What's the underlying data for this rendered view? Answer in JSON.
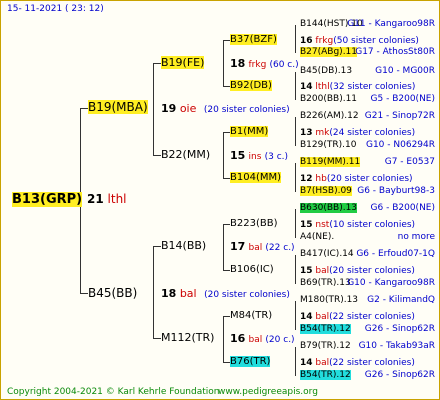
{
  "header": {
    "date": "15- 11-2021 ( 23: 12)"
  },
  "footer": {
    "copyright": "Copyright 2004-2021 © Karl Kehrle Foundation",
    "site": "www.pedigreeapis.org"
  },
  "root": {
    "name": "B13(GRP)",
    "num": "21",
    "place": "lthl"
  },
  "p": {
    "name": "B19(MBA)",
    "num": "19",
    "place": "oie",
    "note": "(20 sister colonies)",
    "p": {
      "name": "B19(FE)",
      "num": "18",
      "place": "frkg",
      "note": "(60 c.)",
      "p": {
        "name": "B37(BZF)",
        "num": "16",
        "place": "frkg",
        "note": "(50 sister colonies)",
        "p": {
          "name": "B144(HST).10",
          "ref": "G11 - Kangaroo98R"
        },
        "m": {
          "name": "B27(ABg).11",
          "ref": "G17 - AthosSt80R"
        }
      },
      "m": {
        "name": "B92(DB)",
        "num": "14",
        "place": "lthl",
        "note": "(32 sister colonies)",
        "p": {
          "name": "B45(DB).13",
          "ref": "G10 - MG00R"
        },
        "m": {
          "name": "B200(BB).11",
          "ref": "G5 - B200(NE)"
        }
      }
    },
    "m": {
      "name": "B22(MM)",
      "num": "15",
      "place": "ins",
      "note": "(3 c.)",
      "p": {
        "name": "B1(MM)",
        "num": "13",
        "place": "mk",
        "note": "(24 sister colonies)",
        "p": {
          "name": "B226(AM).12",
          "ref": "G21 - Sinop72R"
        },
        "m": {
          "name": "B129(TR).10",
          "ref": "G10 - N06294R"
        }
      },
      "m": {
        "name": "B104(MM)",
        "num": "12",
        "place": "hb",
        "note": "(20 sister colonies)",
        "p": {
          "name": "B119(MM).11",
          "ref": "G7 - E0537"
        },
        "m": {
          "name": "B7(HSB).09",
          "ref": "G6 - Bayburt98-3"
        }
      }
    }
  },
  "m": {
    "name": "B45(BB)",
    "num": "18",
    "place": "bal",
    "note": "(20 sister colonies)",
    "p": {
      "name": "B14(BB)",
      "num": "17",
      "place": "bal",
      "note": "(22 c.)",
      "p": {
        "name": "B223(BB)",
        "num": "15",
        "place": "nst",
        "note": "(10 sister colonies)",
        "p": {
          "name": "B630(BB).13",
          "ref": "G6 - B200(NE)"
        },
        "m": {
          "name": "A4(NE).",
          "ref": "no more"
        }
      },
      "m": {
        "name": "B106(IC)",
        "num": "15",
        "place": "bal",
        "note": "(20 sister colonies)",
        "p": {
          "name": "B417(IC).14",
          "ref": "G6 - Erfoud07-1Q"
        },
        "m": {
          "name": "B69(TR).13",
          "ref": "G10 - Kangaroo98R"
        }
      }
    },
    "m": {
      "name": "M112(TR)",
      "num": "16",
      "place": "bal",
      "note": "(20 c.)",
      "p": {
        "name": "M84(TR)",
        "num": "14",
        "place": "bal",
        "note": "(22 sister colonies)",
        "p": {
          "name": "M180(TR).13",
          "ref": "G2 - KilimandQ"
        },
        "m": {
          "name": "B54(TR).12",
          "ref": "G26 - Sinop62R"
        }
      },
      "m": {
        "name": "B76(TR)",
        "num": "14",
        "place": "bal",
        "note": "(22 sister colonies)",
        "p": {
          "name": "B79(TR).12",
          "ref": "G10 - Takab93aR"
        },
        "m": {
          "name": "B54(TR).12",
          "ref": "G26 - Sinop62R"
        }
      }
    }
  }
}
